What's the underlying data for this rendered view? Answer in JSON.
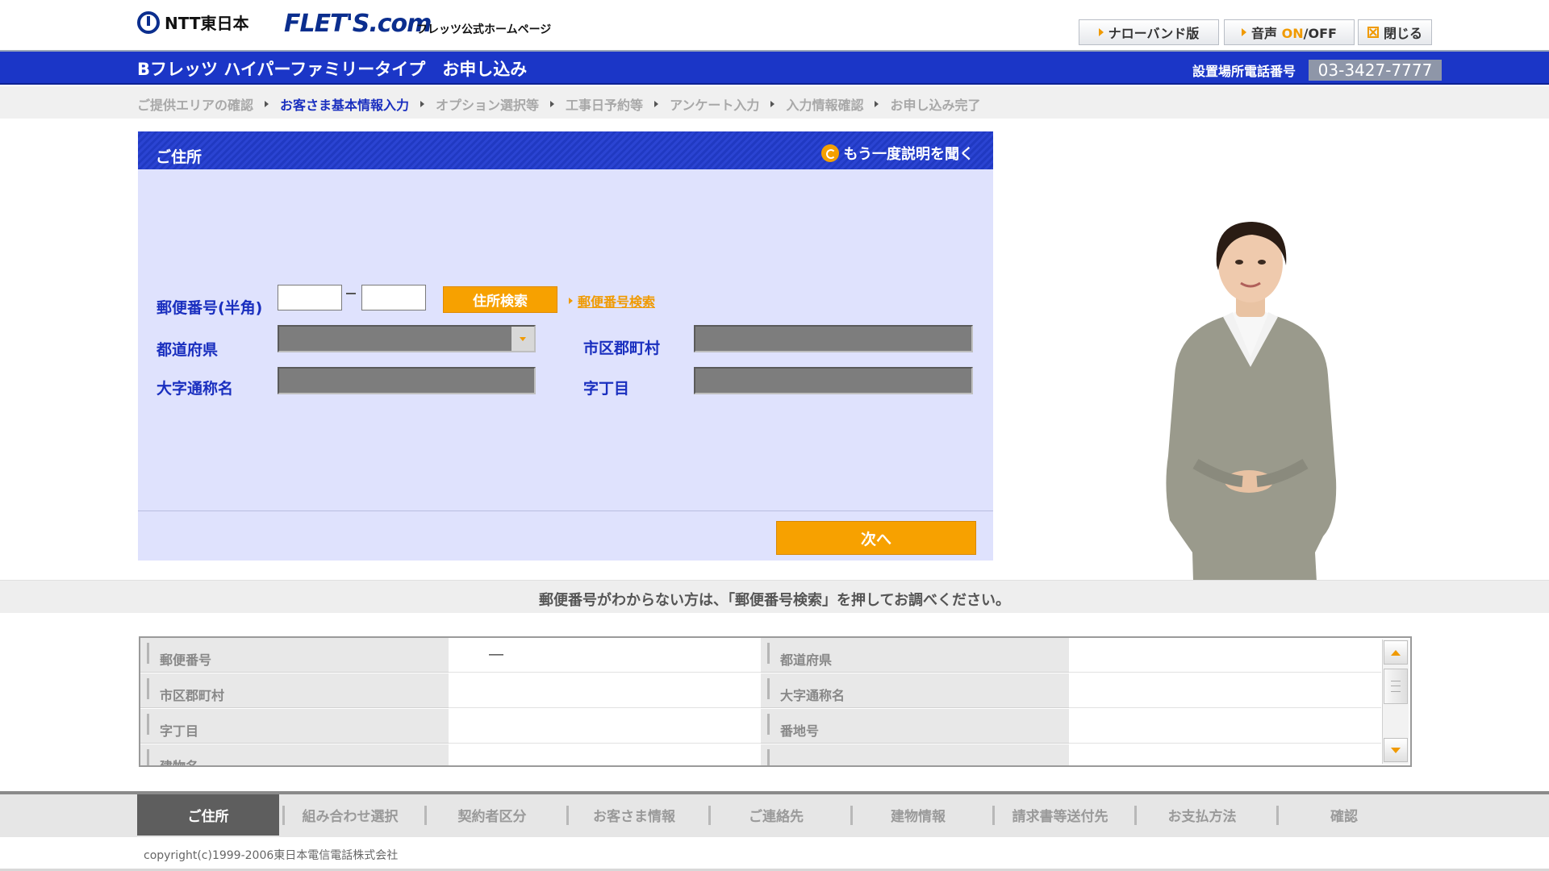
{
  "header": {
    "ntt_logo": "NTT東日本",
    "flets_logo": "FLET'S.com",
    "flets_sub": "フレッツ公式ホームページ",
    "buttons": {
      "narrowband": "ナローバンド版",
      "voice_prefix": "音声",
      "voice_on": "ON",
      "voice_suffix": "/OFF",
      "close": "閉じる"
    }
  },
  "title_bar": {
    "title": "Bフレッツ ハイパーファミリータイプ　お申し込み",
    "phone_label": "設置場所電話番号",
    "phone_number": "03-3427-7777"
  },
  "steps": [
    {
      "label": "ご提供エリアの確認",
      "active": false
    },
    {
      "label": "お客さま基本情報入力",
      "active": true
    },
    {
      "label": "オプション選択等",
      "active": false
    },
    {
      "label": "工事日予約等",
      "active": false
    },
    {
      "label": "アンケート入力",
      "active": false
    },
    {
      "label": "入力情報確認",
      "active": false
    },
    {
      "label": "お申し込み完了",
      "active": false
    }
  ],
  "panel": {
    "title": "ご住所",
    "replay": "もう一度説明を聞く",
    "postal_label": "郵便番号(半角)",
    "postal_first": "",
    "postal_second": "",
    "search_button": "住所検索",
    "zip_link": "郵便番号検索",
    "prefecture_label": "都道府県",
    "city_label": "市区郡町村",
    "oaza_label": "大字通称名",
    "chome_label": "字丁目",
    "next_button": "次へ"
  },
  "info_text": "郵便番号がわからない方は、「郵便番号検索」を押してお調べください。",
  "summary": {
    "rows": [
      {
        "l1": "郵便番号",
        "v1": "―",
        "l2": "都道府県",
        "v2": ""
      },
      {
        "l1": "市区郡町村",
        "v1": "",
        "l2": "大字通称名",
        "v2": ""
      },
      {
        "l1": "字丁目",
        "v1": "",
        "l2": "番地号",
        "v2": ""
      },
      {
        "l1": "建物名",
        "v1": "",
        "l2": "",
        "v2": ""
      }
    ]
  },
  "tabs": [
    "ご住所",
    "組み合わせ選択",
    "契約者区分",
    "お客さま情報",
    "ご連絡先",
    "建物情報",
    "請求書等送付先",
    "お支払方法",
    "確認"
  ],
  "copyright": "copyright(c)1999-2006東日本電信電話株式会社",
  "colors": {
    "brand_blue": "#1b36c7",
    "accent_orange": "#f7a100",
    "panel_bg": "#dfe2fd"
  }
}
